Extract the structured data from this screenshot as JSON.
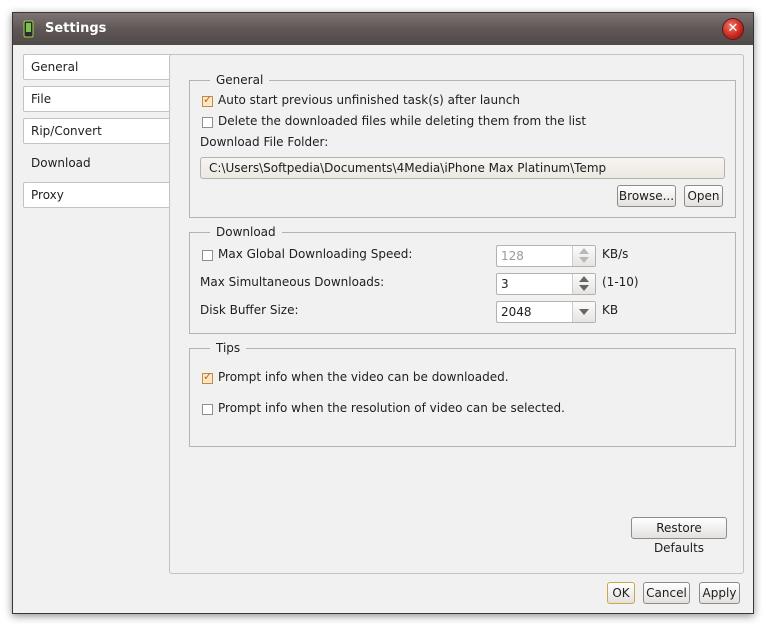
{
  "window": {
    "title": "Settings",
    "close_glyph": "✕"
  },
  "tabs": [
    {
      "label": "General"
    },
    {
      "label": "File"
    },
    {
      "label": "Rip/Convert"
    },
    {
      "label": "Download",
      "active": true
    },
    {
      "label": "Proxy"
    }
  ],
  "general": {
    "legend": "General",
    "auto_start_label": "Auto start previous unfinished task(s) after launch",
    "auto_start_checked": true,
    "delete_files_label": "Delete the downloaded files while deleting them from the list",
    "delete_files_checked": false,
    "folder_label": "Download File Folder:",
    "folder_value": "C:\\Users\\Softpedia\\Documents\\4Media\\iPhone Max Platinum\\Temp",
    "browse_label": "Browse...",
    "open_label": "Open"
  },
  "download": {
    "legend": "Download",
    "max_speed_label": "Max Global Downloading Speed:",
    "max_speed_checked": false,
    "max_speed_value": "128",
    "max_speed_unit": "KB/s",
    "max_sim_label": "Max Simultaneous Downloads:",
    "max_sim_value": "3",
    "max_sim_range": "(1-10)",
    "buffer_label": "Disk Buffer Size:",
    "buffer_value": "2048",
    "buffer_unit": "KB"
  },
  "tips": {
    "legend": "Tips",
    "prompt_download_label": "Prompt info when the video can be downloaded.",
    "prompt_download_checked": true,
    "prompt_resolution_label": "Prompt info when the resolution of video can be selected.",
    "prompt_resolution_checked": false
  },
  "restore_defaults_label": "Restore Defaults",
  "footer": {
    "ok_label": "OK",
    "cancel_label": "Cancel",
    "apply_label": "Apply"
  },
  "colors": {
    "titlebar": "#5e5756",
    "close": "#c6241a",
    "check_accent": "#b06a1e"
  },
  "icons": {
    "app": "phone-app-icon",
    "close": "close-icon"
  }
}
